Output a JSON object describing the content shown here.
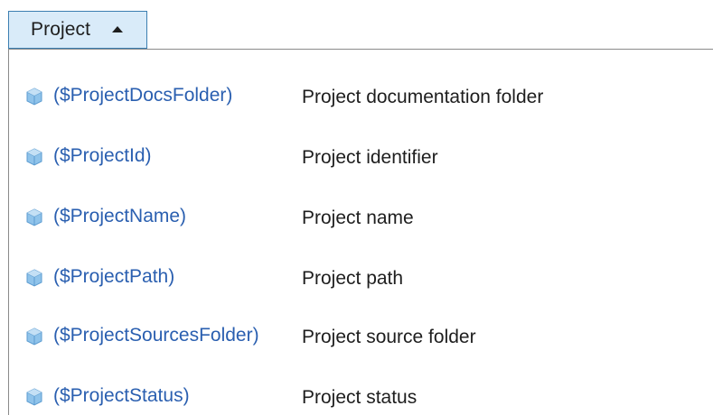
{
  "dropdown": {
    "label": "Project",
    "state": "expanded"
  },
  "items": [
    {
      "macro": "($ProjectDocsFolder)",
      "description": "Project documentation folder",
      "icon": "cube-icon"
    },
    {
      "macro": "($ProjectId)",
      "description": "Project identifier",
      "icon": "cube-icon"
    },
    {
      "macro": "($ProjectName)",
      "description": "Project name",
      "icon": "cube-icon"
    },
    {
      "macro": "($ProjectPath)",
      "description": "Project path",
      "icon": "cube-icon"
    },
    {
      "macro": "($ProjectSourcesFolder)",
      "description": "Project source folder",
      "icon": "cube-icon"
    },
    {
      "macro": "($ProjectStatus)",
      "description": "Project status",
      "icon": "cube-icon"
    }
  ],
  "colors": {
    "button_bg": "#d9ebf9",
    "button_border": "#3c7fb1",
    "macro_text": "#2a5fb0",
    "desc_text": "#1e1e1e",
    "icon_fill": "#8fc3ea"
  }
}
